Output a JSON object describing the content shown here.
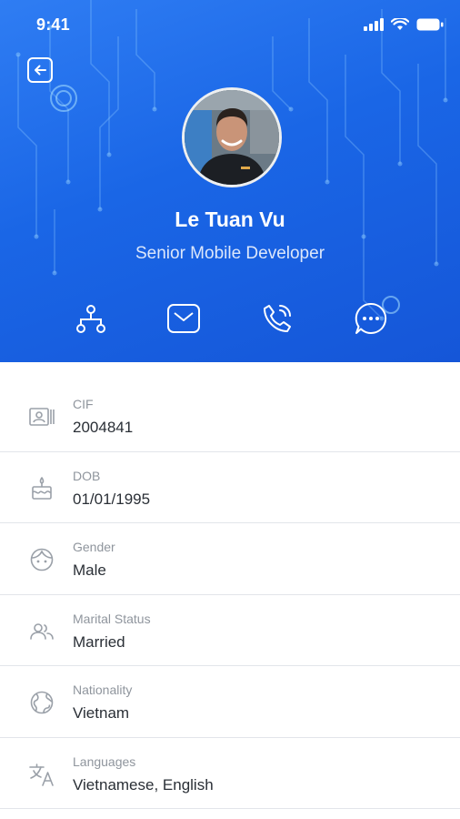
{
  "status_bar": {
    "time": "9:41"
  },
  "profile": {
    "name": "Le Tuan Vu",
    "title": "Senior Mobile Developer"
  },
  "actions": [
    {
      "icon": "org-chart-icon"
    },
    {
      "icon": "mail-icon"
    },
    {
      "icon": "phone-call-icon"
    },
    {
      "icon": "chat-bubble-icon"
    }
  ],
  "info": [
    {
      "icon": "id-card-icon",
      "label": "CIF",
      "value": "2004841"
    },
    {
      "icon": "birthday-cake-icon",
      "label": "DOB",
      "value": "01/01/1995"
    },
    {
      "icon": "face-icon",
      "label": "Gender",
      "value": "Male"
    },
    {
      "icon": "people-icon",
      "label": "Marital Status",
      "value": "Married"
    },
    {
      "icon": "globe-icon",
      "label": "Nationality",
      "value": "Vietnam"
    },
    {
      "icon": "translate-icon",
      "label": "Languages",
      "value": "Vietnamese, English"
    }
  ],
  "colors": {
    "header_blue": "#1a66e6",
    "label_gray": "#8f959d",
    "value_dark": "#2a2f36",
    "icon_gray": "#9aa0a8"
  }
}
